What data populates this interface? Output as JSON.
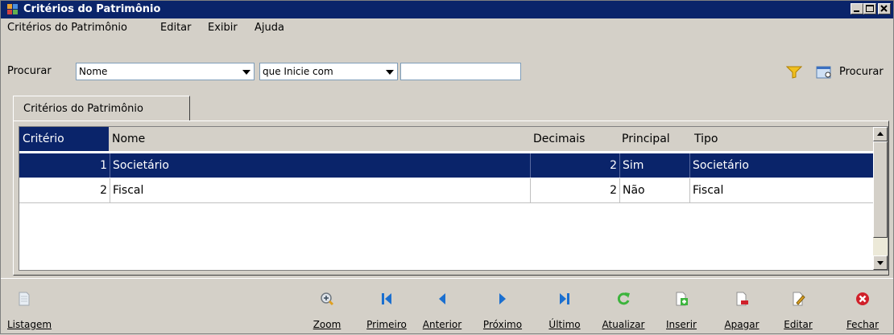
{
  "window": {
    "title": "Critérios do Patrimônio"
  },
  "menu": {
    "items": [
      "Critérios do Patrimônio",
      "Editar",
      "Exibir",
      "Ajuda"
    ]
  },
  "search": {
    "label": "Procurar",
    "field_value": "Nome",
    "operator_value": "que Inicie com",
    "text_value": "",
    "search_button_label": "Procurar"
  },
  "tabs": [
    {
      "label": "Critérios do Patrimônio"
    }
  ],
  "grid": {
    "columns": [
      "Critério",
      "Nome",
      "Decimais",
      "Principal",
      "Tipo"
    ],
    "rows": [
      {
        "criterio": "1",
        "nome": "Societário",
        "decimais": "2",
        "principal": "Sim",
        "tipo": "Societário"
      },
      {
        "criterio": "2",
        "nome": "Fiscal",
        "decimais": "2",
        "principal": "Não",
        "tipo": "Fiscal"
      }
    ]
  },
  "toolbar": {
    "listagem": "Listagem",
    "zoom": "Zoom",
    "primeiro": "Primeiro",
    "anterior": "Anterior",
    "proximo": "Próximo",
    "ultimo": "Último",
    "atualizar": "Atualizar",
    "inserir": "Inserir",
    "apagar": "Apagar",
    "editar": "Editar",
    "fechar": "Fechar"
  },
  "colors": {
    "title_bar": "#0a246a",
    "selection": "#0a246a",
    "nav_blue": "#1a6fd0",
    "refresh_green": "#3cb43c",
    "close_red": "#d0202a"
  }
}
